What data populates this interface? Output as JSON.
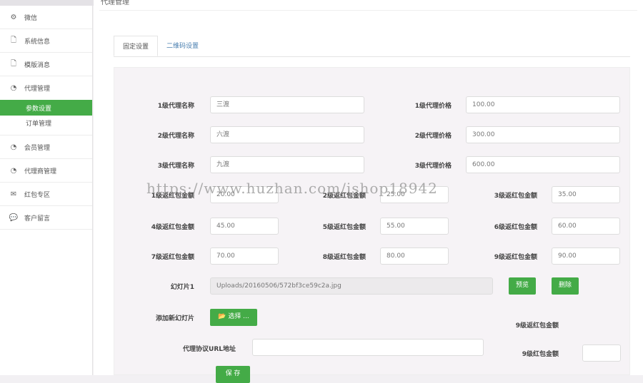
{
  "page_title": "代理管理",
  "sidebar": {
    "items": [
      {
        "label": "微信",
        "icon": "gears-icon"
      },
      {
        "label": "系统信息",
        "icon": "file-icon"
      },
      {
        "label": "模版消息",
        "icon": "file-icon"
      },
      {
        "label": "代理管理",
        "icon": "rss-icon"
      }
    ],
    "sub": [
      {
        "label": "参数设置"
      },
      {
        "label": "订单管理"
      }
    ],
    "items2": [
      {
        "label": "会员管理",
        "icon": "rss-icon"
      },
      {
        "label": "代理商管理",
        "icon": "rss-icon"
      },
      {
        "label": "红包专区",
        "icon": "mail-icon"
      },
      {
        "label": "客户留言",
        "icon": "comments-icon"
      }
    ]
  },
  "tabs": [
    "固定设置",
    "二维码设置"
  ],
  "agents": [
    {
      "name_label": "1级代理名称",
      "name": "三渡",
      "price_label": "1级代理价格",
      "price": "100.00"
    },
    {
      "name_label": "2级代理名称",
      "name": "六渡",
      "price_label": "2级代理价格",
      "price": "300.00"
    },
    {
      "name_label": "3级代理名称",
      "name": "九渡",
      "price_label": "3级代理价格",
      "price": "600.00"
    }
  ],
  "rebates": [
    {
      "label": "1级返红包金额",
      "value": "20.00"
    },
    {
      "label": "2级返红包金额",
      "value": "25.00"
    },
    {
      "label": "3级返红包金额",
      "value": "35.00"
    },
    {
      "label": "4级返红包金额",
      "value": "45.00"
    },
    {
      "label": "5级返红包金额",
      "value": "55.00"
    },
    {
      "label": "6级返红包金额",
      "value": "60.00"
    },
    {
      "label": "7级返红包金额",
      "value": "70.00"
    },
    {
      "label": "8级返红包金额",
      "value": "80.00"
    },
    {
      "label": "9级返红包金额",
      "value": "90.00"
    }
  ],
  "slide": {
    "label": "幻灯片1",
    "value": "Uploads/20160506/572bf3ce59c2a.jpg",
    "preview": "预览",
    "delete": "删除"
  },
  "add_slide": {
    "label": "添加新幻灯片",
    "button": "选择 ..."
  },
  "url": {
    "label": "代理协议URL地址",
    "value": ""
  },
  "extra": {
    "label1": "9级返红包金额",
    "label2": "9级红包金额"
  },
  "save": "保 存",
  "watermark": "https://www.huzhan.com/ishop18942"
}
